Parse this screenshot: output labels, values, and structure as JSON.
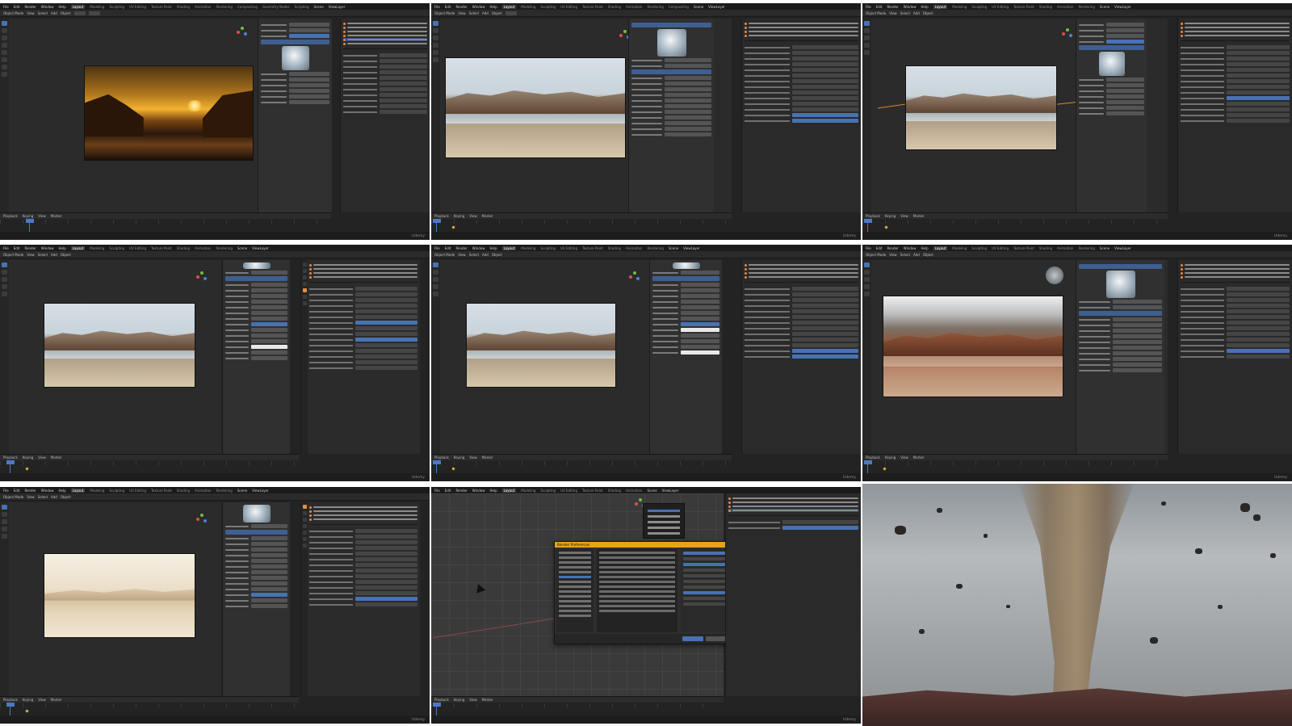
{
  "menu": {
    "items": [
      "File",
      "Edit",
      "Render",
      "Window",
      "Help"
    ],
    "workspaces": [
      "Layout",
      "Modeling",
      "Sculpting",
      "UV Editing",
      "Texture Paint",
      "Shading",
      "Animation",
      "Rendering",
      "Compositing",
      "Geometry Nodes",
      "Scripting"
    ],
    "active_workspace": "Layout",
    "scene_label": "Scene",
    "view_layer_label": "ViewLayer"
  },
  "viewport_header": {
    "mode": "Object Mode",
    "items": [
      "View",
      "Select",
      "Add",
      "Object"
    ]
  },
  "timeline": {
    "items": [
      "Playback",
      "Keying",
      "View",
      "Marker"
    ]
  },
  "watermark": "Udemy",
  "prefs_dialog": {
    "title": "Blender Preferences"
  },
  "colors": {
    "blender_bg": "#232323",
    "accent_blue": "#4772b3",
    "header_orange": "#e8a21e",
    "keyframe_yellow": "#e0b43a"
  }
}
